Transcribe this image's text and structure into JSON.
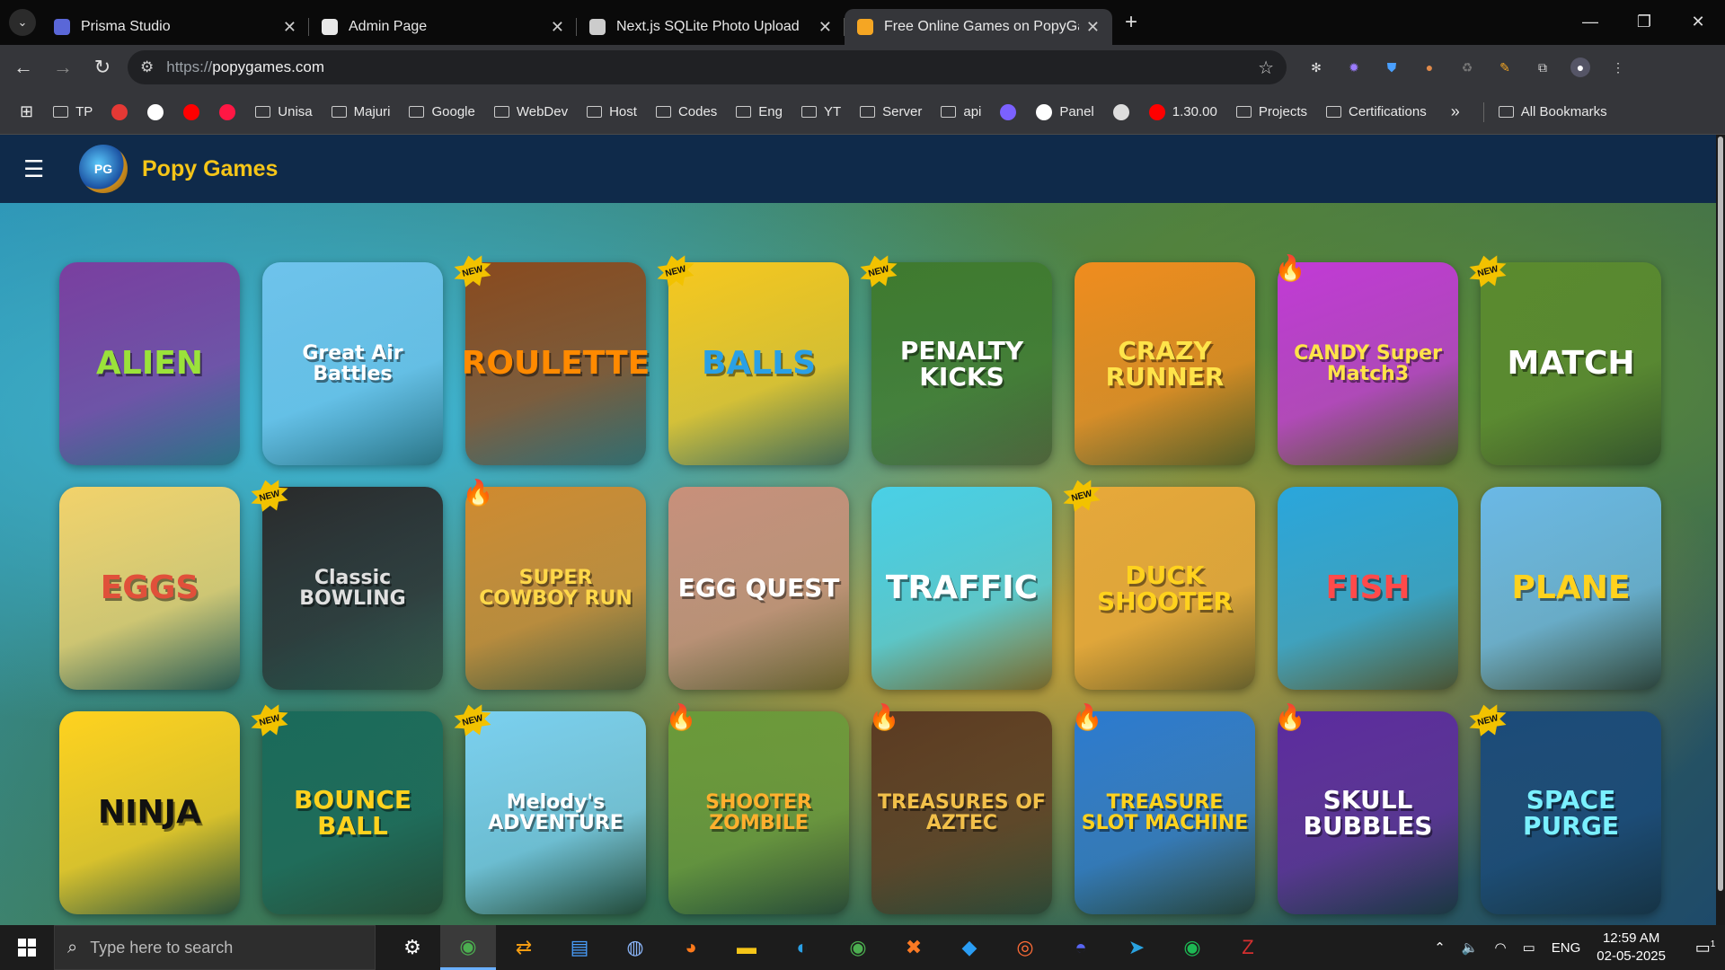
{
  "browser": {
    "tabs": [
      {
        "title": "Prisma Studio",
        "color": "#5a67d8",
        "active": false
      },
      {
        "title": "Admin Page",
        "color": "#e8e8e8",
        "active": false
      },
      {
        "title": "Next.js SQLite Photo Upload",
        "color": "#cccccc",
        "active": false
      },
      {
        "title": "Free Online Games on PopyGames",
        "color": "#f5a623",
        "active": true
      }
    ],
    "new_tab": "+",
    "url_protocol": "https://",
    "url_host": "popygames.com",
    "bookmarks": [
      {
        "label": "TP",
        "type": "folder"
      },
      {
        "label": "",
        "type": "icon",
        "color": "#e53935"
      },
      {
        "label": "",
        "type": "icon",
        "color": "#ffffff"
      },
      {
        "label": "",
        "type": "icon",
        "color": "#ff0000"
      },
      {
        "label": "",
        "type": "icon",
        "color": "#ff1744"
      },
      {
        "label": "Unisa",
        "type": "folder"
      },
      {
        "label": "Majuri",
        "type": "folder"
      },
      {
        "label": "Google",
        "type": "folder"
      },
      {
        "label": "WebDev",
        "type": "folder"
      },
      {
        "label": "Host",
        "type": "folder"
      },
      {
        "label": "Codes",
        "type": "folder"
      },
      {
        "label": "Eng",
        "type": "folder"
      },
      {
        "label": "YT",
        "type": "folder"
      },
      {
        "label": "Server",
        "type": "folder"
      },
      {
        "label": "api",
        "type": "folder"
      },
      {
        "label": "",
        "type": "icon",
        "color": "#7b61ff"
      },
      {
        "label": "Panel",
        "type": "site",
        "color": "#ffffff"
      },
      {
        "label": "",
        "type": "icon",
        "color": "#dddddd"
      },
      {
        "label": "1.30.00",
        "type": "site",
        "color": "#ff0000"
      },
      {
        "label": "Projects",
        "type": "folder"
      },
      {
        "label": "Certifications",
        "type": "folder"
      }
    ],
    "bookmarks_more": "»",
    "all_bookmarks": "All Bookmarks"
  },
  "site": {
    "brand": "Popy Games",
    "brand_color": "#f5c518",
    "games": [
      {
        "title": "ALIEN",
        "badge": "",
        "bg": "#7a3fa0",
        "fg": "#9be23a"
      },
      {
        "title": "Great Air Battles",
        "badge": "",
        "bg": "#6ec3ec",
        "fg": "#ffffff"
      },
      {
        "title": "ROULETTE",
        "badge": "new",
        "bg": "#8a4a1e",
        "fg": "#ff8a00"
      },
      {
        "title": "BALLS",
        "badge": "new",
        "bg": "#f7c81e",
        "fg": "#2aa0e6"
      },
      {
        "title": "PENALTY KICKS",
        "badge": "new",
        "bg": "#3f7a2e",
        "fg": "#ffffff"
      },
      {
        "title": "CRAZY RUNNER",
        "badge": "",
        "bg": "#f08c1e",
        "fg": "#ffe34a"
      },
      {
        "title": "CANDY Super Match3",
        "badge": "hot",
        "bg": "#c23ad6",
        "fg": "#ffe34a"
      },
      {
        "title": "MATCH",
        "badge": "new",
        "bg": "#5a8a2e",
        "fg": "#ffffff"
      },
      {
        "title": "EGGS",
        "badge": "",
        "bg": "#f2d26a",
        "fg": "#e0503a"
      },
      {
        "title": "Classic BOWLING",
        "badge": "new",
        "bg": "#2a2a2a",
        "fg": "#e0e0e0"
      },
      {
        "title": "SUPER COWBOY RUN",
        "badge": "hot",
        "bg": "#d08a2e",
        "fg": "#ffd84a"
      },
      {
        "title": "EGG QUEST",
        "badge": "",
        "bg": "#c9907a",
        "fg": "#ffffff"
      },
      {
        "title": "TRAFFIC",
        "badge": "",
        "bg": "#4ad0e6",
        "fg": "#ffffff"
      },
      {
        "title": "DUCK SHOOTER",
        "badge": "new",
        "bg": "#e8a83a",
        "fg": "#ffd21e"
      },
      {
        "title": "FISH",
        "badge": "",
        "bg": "#2aa6dc",
        "fg": "#ff4a4a"
      },
      {
        "title": "PLANE",
        "badge": "",
        "bg": "#6ab8e6",
        "fg": "#ffd21e"
      },
      {
        "title": "NINJA",
        "badge": "",
        "bg": "#ffd21e",
        "fg": "#111111"
      },
      {
        "title": "BOUNCE BALL",
        "badge": "new",
        "bg": "#1a6a5a",
        "fg": "#ffd21e"
      },
      {
        "title": "Melody's ADVENTURE",
        "badge": "new",
        "bg": "#7ad0f0",
        "fg": "#ffffff"
      },
      {
        "title": "SHOOTER ZOMBILE",
        "badge": "hot",
        "bg": "#6a9a3a",
        "fg": "#ffb02e"
      },
      {
        "title": "TREASURES OF AZTEC",
        "badge": "hot",
        "bg": "#5a3a22",
        "fg": "#f2c04a"
      },
      {
        "title": "TREASURE SLOT MACHINE",
        "badge": "hot",
        "bg": "#2a7ad0",
        "fg": "#ffd21e"
      },
      {
        "title": "SKULL BUBBLES",
        "badge": "hot",
        "bg": "#5a2aa0",
        "fg": "#ffffff"
      },
      {
        "title": "SPACE PURGE",
        "badge": "new",
        "bg": "#1a4a7a",
        "fg": "#7af0ff"
      }
    ]
  },
  "taskbar": {
    "search_placeholder": "Type here to search",
    "apps": [
      "settings-icon",
      "chrome-icon",
      "tool-icon",
      "laptop-icon",
      "steam-icon",
      "firefox-icon",
      "explorer-icon",
      "edge-icon",
      "chrome-icon",
      "xampp-icon",
      "vscode-icon",
      "postman-icon",
      "discord-icon",
      "telegram-icon",
      "spotify-icon",
      "filezilla-icon"
    ],
    "language": "ENG",
    "time": "12:59 AM",
    "date": "02-05-2025",
    "notifications": "1"
  }
}
